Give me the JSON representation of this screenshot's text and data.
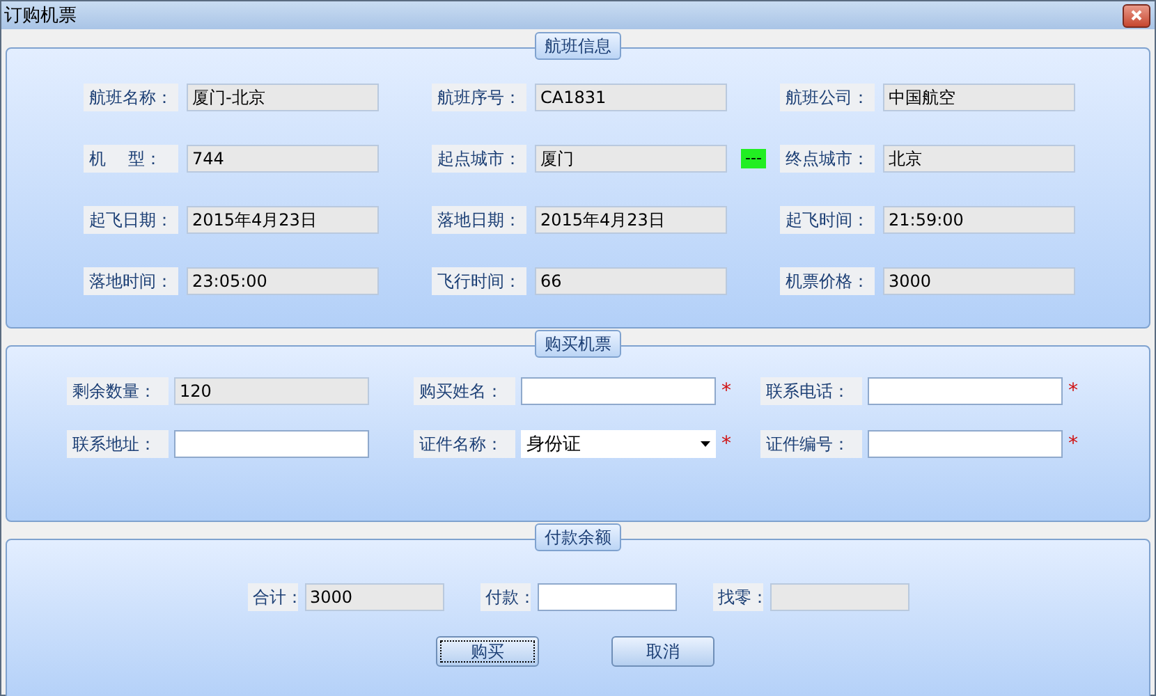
{
  "window": {
    "title": "订购机票"
  },
  "flight_info": {
    "title": "航班信息",
    "fields": [
      {
        "label": "航班名称：",
        "value": "厦门-北京",
        "readonly": true
      },
      {
        "label": "航班序号：",
        "value": "CA1831",
        "readonly": true
      },
      {
        "label": "航班公司：",
        "value": "中国航空",
        "readonly": true
      },
      {
        "label": "机　 型：",
        "value": "744",
        "readonly": true
      },
      {
        "label": "起点城市：",
        "value": "厦门",
        "readonly": true,
        "connector": "---"
      },
      {
        "label": "终点城市：",
        "value": "北京",
        "readonly": true
      },
      {
        "label": "起飞日期：",
        "value": "2015年4月23日",
        "readonly": true
      },
      {
        "label": "落地日期：",
        "value": "2015年4月23日",
        "readonly": true
      },
      {
        "label": "起飞时间：",
        "value": "21:59:00",
        "readonly": true
      },
      {
        "label": "落地时间：",
        "value": "23:05:00",
        "readonly": true
      },
      {
        "label": "飞行时间：",
        "value": "66",
        "readonly": true
      },
      {
        "label": "机票价格：",
        "value": "3000",
        "readonly": true
      }
    ]
  },
  "purchase": {
    "title": "购买机票",
    "fields": [
      {
        "label": "剩余数量：",
        "kind": "text",
        "value": "120",
        "readonly": true
      },
      {
        "label": "购买姓名：",
        "kind": "text",
        "readonly": false,
        "required_mark": "*"
      },
      {
        "label": "联系电话：",
        "kind": "text",
        "readonly": false,
        "required_mark": "*"
      },
      {
        "label": "联系地址：",
        "kind": "text",
        "readonly": false
      },
      {
        "label": "证件名称：",
        "kind": "select",
        "value": "身份证",
        "readonly": false,
        "required_mark": "*"
      },
      {
        "label": "证件编号：",
        "kind": "text",
        "readonly": false,
        "required_mark": "*"
      }
    ]
  },
  "payment": {
    "title": "付款余额",
    "fields": [
      {
        "label": "合计：",
        "value": "3000",
        "readonly": true
      },
      {
        "label": "付款：",
        "readonly": false
      },
      {
        "label": "找零：",
        "readonly": true
      }
    ],
    "buttons": [
      {
        "label": "购买",
        "focused": true
      },
      {
        "label": "取消",
        "focused": false
      }
    ]
  }
}
